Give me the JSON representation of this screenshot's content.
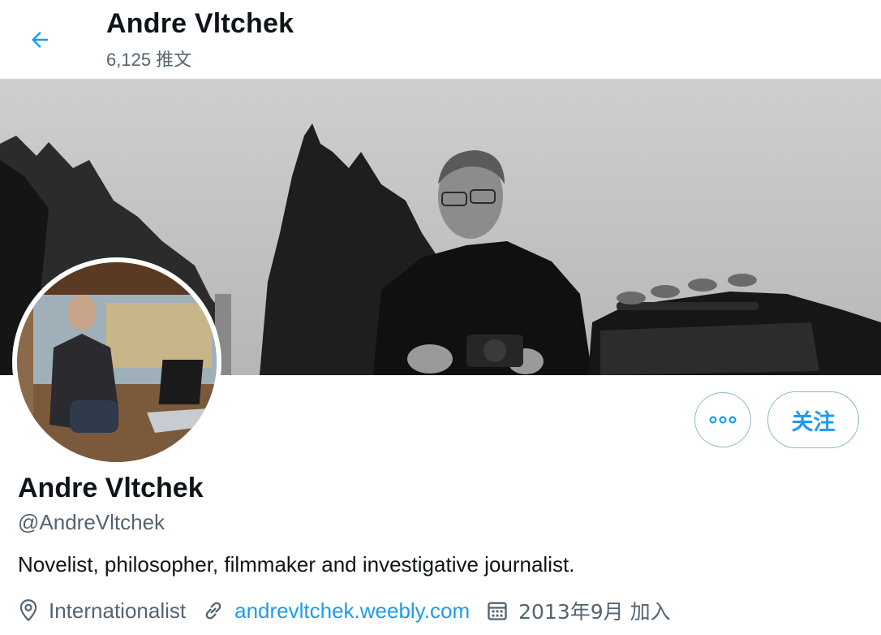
{
  "header": {
    "title": "Andre Vltchek",
    "tweet_count": "6,125 推文"
  },
  "profile": {
    "name": "Andre Vltchek",
    "handle": "@AndreVltchek",
    "bio": "Novelist, philosopher, filmmaker and investigative journalist.",
    "location": "Internationalist",
    "website": "andrevltchek.weebly.com",
    "joined": "2013年9月 加入"
  },
  "actions": {
    "follow_label": "关注",
    "more_icon": "more-horizontal-icon"
  },
  "colors": {
    "accent": "#1d9bf0",
    "secondary_text": "#536471",
    "button_border": "#8fb9c9"
  }
}
